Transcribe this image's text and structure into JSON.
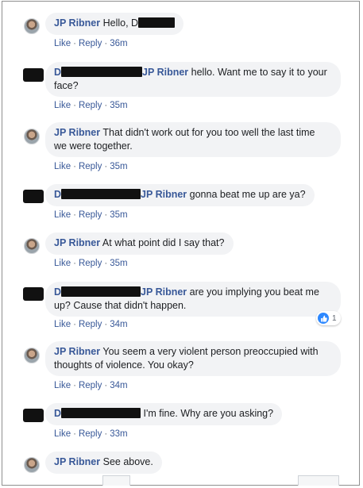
{
  "comments": [
    {
      "author": "JP Ribner",
      "author_prefix": "",
      "text": "Hello, D",
      "tagged": "",
      "line2": "",
      "like": "Like",
      "reply": "Reply",
      "time": "36m",
      "avatar": "photo"
    },
    {
      "author": "D",
      "author_prefix": "",
      "text": "hello. Want me to say it to your",
      "tagged": "JP Ribner",
      "line2": "face?",
      "like": "Like",
      "reply": "Reply",
      "time": "35m",
      "avatar": "redacted"
    },
    {
      "author": "JP Ribner",
      "text": "That didn't work out for you too well the last time",
      "line2": "we were together.",
      "like": "Like",
      "reply": "Reply",
      "time": "35m",
      "avatar": "photo"
    },
    {
      "author": "D",
      "tagged": "JP Ribner",
      "text": "gonna beat me up are ya?",
      "like": "Like",
      "reply": "Reply",
      "time": "35m",
      "avatar": "redacted"
    },
    {
      "author": "JP Ribner",
      "text": "At what point did I say that?",
      "like": "Like",
      "reply": "Reply",
      "time": "35m",
      "avatar": "photo"
    },
    {
      "author": "D",
      "tagged": "JP Ribner",
      "text": "are you implying you beat me",
      "line2": "up? Cause that didn't happen.",
      "like": "Like",
      "reply": "Reply",
      "time": "34m",
      "avatar": "redacted",
      "reaction_count": "1"
    },
    {
      "author": "JP Ribner",
      "text": "You seem a very violent person preoccupied with",
      "line2": "thoughts of violence. You okay?",
      "like": "Like",
      "reply": "Reply",
      "time": "34m",
      "avatar": "photo"
    },
    {
      "author": "D",
      "text": "I'm fine. Why are you asking?",
      "like": "Like",
      "reply": "Reply",
      "time": "33m",
      "avatar": "redacted"
    },
    {
      "author": "JP Ribner",
      "text": "See above.",
      "avatar": "photo"
    }
  ],
  "separator": "·",
  "colors": {
    "author_link": "#385898",
    "bubble_bg": "#f2f3f5",
    "meta_text": "#606770",
    "like_reaction": "#2d88ff"
  },
  "icons": {
    "reaction": "thumbs-up-icon"
  }
}
